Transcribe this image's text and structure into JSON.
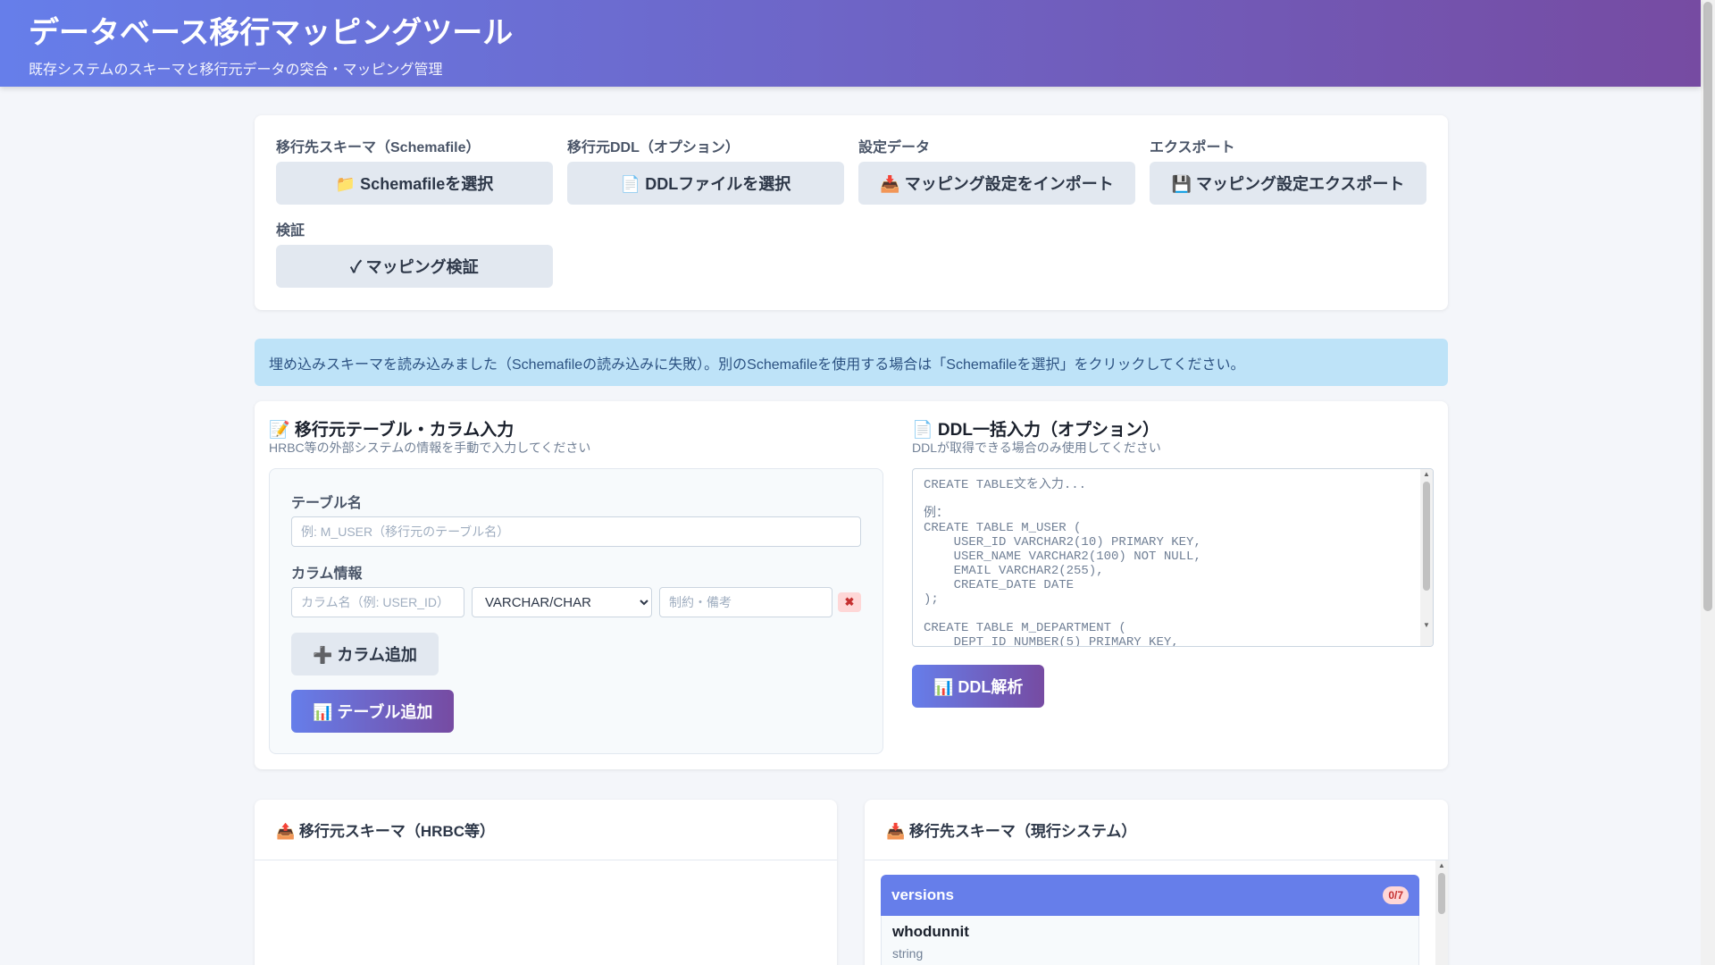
{
  "header": {
    "title": "データベース移行マッピングツール",
    "subtitle": "既存システムのスキーマと移行元データの突合・マッピング管理"
  },
  "toolbar": {
    "schema_label": "移行先スキーマ（Schemafile）",
    "schema_button": "📁 Schemafileを選択",
    "ddl_label": "移行元DDL（オプション）",
    "ddl_button": "📄 DDLファイルを選択",
    "settings_label": "設定データ",
    "import_button": "📥 マッピング設定をインポート",
    "export_label": "エクスポート",
    "export_button": "💾 マッピング設定エクスポート",
    "verify_label": "検証",
    "verify_button": "✓ マッピング検証"
  },
  "alert": "埋め込みスキーマを読み込みました（Schemafileの読み込みに失敗）。別のSchemafileを使用する場合は「Schemafileを選択」をクリックしてください。",
  "manual_input": {
    "title": "📝 移行元テーブル・カラム入力",
    "subtitle": "HRBC等の外部システムの情報を手動で入力してください",
    "table_name_label": "テーブル名",
    "table_name_placeholder": "例: M_USER（移行元のテーブル名）",
    "column_info_label": "カラム情報",
    "column_name_placeholder": "カラム名（例: USER_ID）",
    "column_type_selected": "VARCHAR/CHAR",
    "column_note_placeholder": "制約・備考",
    "delete_icon": "✖",
    "add_column_button": "➕ カラム追加",
    "add_table_button": "📊 テーブル追加"
  },
  "ddl_input": {
    "title": "📄 DDL一括入力（オプション）",
    "subtitle": "DDLが取得できる場合のみ使用してください",
    "placeholder": "CREATE TABLE文を入力...\n\n例：\nCREATE TABLE M_USER (\n    USER_ID VARCHAR2(10) PRIMARY KEY,\n    USER_NAME VARCHAR2(100) NOT NULL,\n    EMAIL VARCHAR2(255),\n    CREATE_DATE DATE\n);\n\nCREATE TABLE M_DEPARTMENT (\n    DEPT_ID NUMBER(5) PRIMARY KEY,",
    "parse_button": "📊 DDL解析"
  },
  "source_panel": {
    "title": "📤 移行元スキーマ（HRBC等）"
  },
  "target_panel": {
    "title": "📥 移行先スキーマ（現行システム）",
    "table": {
      "name": "versions",
      "badge": "0/7",
      "columns": [
        {
          "name": "whodunnit",
          "type": "string"
        }
      ]
    }
  }
}
